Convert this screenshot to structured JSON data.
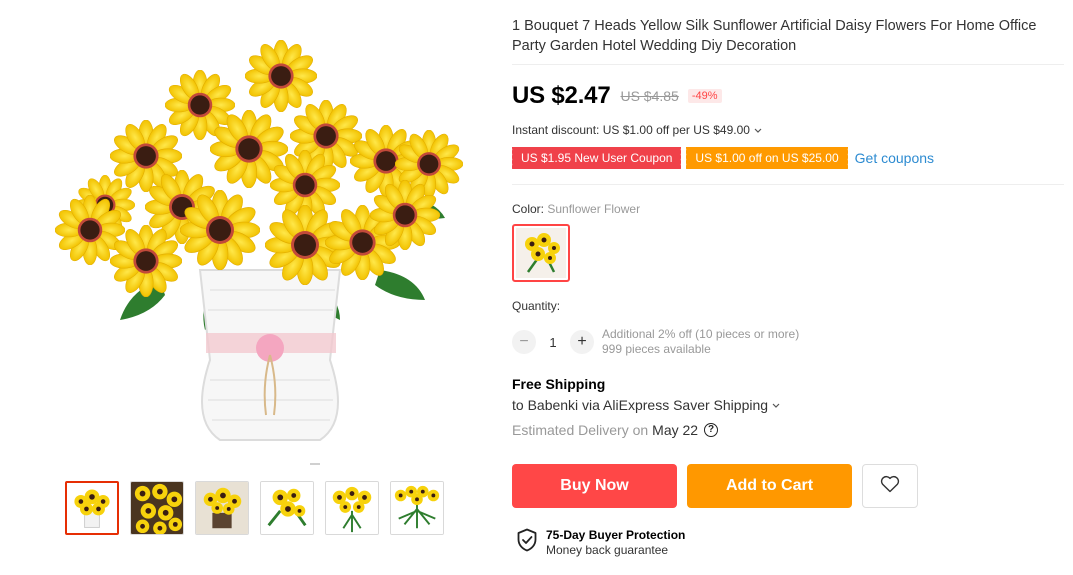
{
  "product": {
    "title": "1 Bouquet 7 Heads Yellow Silk Sunflower Artificial Daisy Flowers For Home Office Party Garden Hotel Wedding Diy Decoration",
    "price": "US $2.47",
    "original_price": "US $4.85",
    "discount": "-49%"
  },
  "promotions": {
    "instant_discount": "Instant discount: US $1.00 off per US $49.00",
    "coupons": [
      "US $1.95 New User Coupon",
      "US $1.00 off on US $25.00"
    ],
    "get_coupons": "Get coupons"
  },
  "color": {
    "label": "Color:",
    "selected": "Sunflower Flower"
  },
  "quantity": {
    "label": "Quantity:",
    "value": "1",
    "minus": "−",
    "plus": "+",
    "note1": "Additional 2% off (10 pieces or more)",
    "note2": "999 pieces available"
  },
  "shipping": {
    "title": "Free Shipping",
    "line": "to Babenki via AliExpress Saver Shipping",
    "delivery_label": "Estimated Delivery on",
    "delivery_date": "May 22",
    "help": "?"
  },
  "actions": {
    "buy_now": "Buy Now",
    "add_to_cart": "Add to Cart"
  },
  "protection": {
    "title": "75-Day Buyer Protection",
    "subtitle": "Money back guarantee"
  },
  "gallery": {
    "thumbnail_count": 6,
    "active_index": 0
  },
  "colors": {
    "accent_red": "#ff4747",
    "accent_orange": "#ff9800",
    "link_blue": "#2d8bd1",
    "sunflower_yellow": "#f7d20c"
  },
  "icons": [
    "chevron-down-icon",
    "question-circle-icon",
    "heart-icon",
    "shield-check-icon"
  ]
}
